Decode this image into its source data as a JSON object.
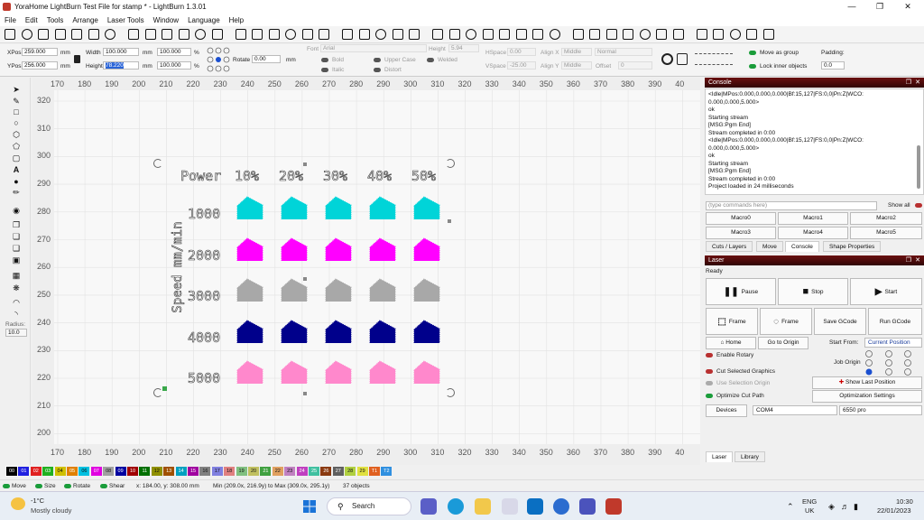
{
  "window": {
    "title": "YoraHome LightBurn Test File  for stamp * - LightBurn 1.3.01"
  },
  "menu": [
    "File",
    "Edit",
    "Tools",
    "Arrange",
    "Laser Tools",
    "Window",
    "Language",
    "Help"
  ],
  "props": {
    "xpos_label": "XPos",
    "xpos": "259.000",
    "ypos_label": "YPos",
    "ypos": "256.000",
    "unit": "mm",
    "width_label": "Width",
    "width": "100.000",
    "height_label": "Height",
    "height": "78.220",
    "scale_w": "100.000",
    "scale_h": "100.000",
    "pct": "%",
    "rotate_label": "Rotate",
    "rotate": "0.00",
    "font_label": "Font",
    "font": "Arial",
    "height5_label": "Height",
    "height5": "5.94",
    "hspace_label": "HSpace",
    "hspace": "0.00",
    "vspace_label": "VSpace",
    "vspace": "-25.00",
    "alignx_label": "Align X",
    "alignx": "Middle",
    "aligny_label": "Align Y",
    "aligny": "Middle",
    "mode": "Normal",
    "offset_label": "Offset",
    "offset": "0",
    "bold": "Bold",
    "italic": "Italic",
    "upper": "Upper Case",
    "distort": "Distort",
    "welded": "Welded",
    "move_group": "Move as group",
    "lock_inner": "Lock inner objects",
    "padding_label": "Padding:",
    "padding": "0.0"
  },
  "ruler": {
    "top": [
      "170",
      "180",
      "190",
      "200",
      "210",
      "220",
      "230",
      "240",
      "250",
      "260",
      "270",
      "280",
      "290",
      "300",
      "310",
      "320",
      "330",
      "340",
      "350",
      "360",
      "370",
      "380",
      "390",
      "40"
    ],
    "left": [
      "320",
      "310",
      "300",
      "290",
      "280",
      "270",
      "260",
      "250",
      "240",
      "230",
      "220",
      "210",
      "200"
    ]
  },
  "left_tools": {
    "radius_label": "Radius:",
    "radius": "10.0"
  },
  "design": {
    "power_label": "Power",
    "cols": [
      "10%",
      "20%",
      "30%",
      "40%",
      "50%"
    ],
    "speed_label": "Speed mm/min",
    "rows": [
      "1000",
      "2000",
      "3000",
      "4000",
      "5000"
    ],
    "row_colors": [
      "#00d4d8",
      "#ff00ff",
      "#a8a8a8",
      "#00008b",
      "#ff88cc"
    ]
  },
  "console": {
    "title": "Console",
    "lines": [
      "<Idle|MPos:0.000,0.000,0.000|Bf:15,127|FS:0,0|Pn:Z|WCO:",
      "0.000,0.000,5.000>",
      "ok",
      "Starting stream",
      "[MSG:Pgm End]",
      "Stream completed in 0:00",
      "<Idle|MPos:0.000,0.000,0.000|Bf:15,127|FS:0,0|Pn:Z|WCO:",
      "0.000,0.000,5.000>",
      "ok",
      "Starting stream",
      "[MSG:Pgm End]",
      "Stream completed in 0:00",
      "Project loaded in 24 milliseconds"
    ],
    "input_placeholder": "(type commands here)",
    "show_all": "Show all",
    "macros": [
      "Macro0",
      "Macro1",
      "Macro2",
      "Macro3",
      "Macro4",
      "Macro5"
    ]
  },
  "tabs1": [
    "Cuts / Layers",
    "Move",
    "Console",
    "Shape Properties"
  ],
  "laser": {
    "title": "Laser",
    "status": "Ready",
    "pause": "Pause",
    "stop": "Stop",
    "start": "Start",
    "frame1": "Frame",
    "frame2": "Frame",
    "save_gcode": "Save GCode",
    "run_gcode": "Run GCode",
    "home": "Home",
    "go_origin": "Go to Origin",
    "start_from_label": "Start From:",
    "start_from": "Current Position",
    "enable_rotary": "Enable Rotary",
    "job_origin": "Job Origin",
    "cut_selected": "Cut Selected Graphics",
    "use_sel_origin": "Use Selection Origin",
    "show_last": "Show Last Position",
    "optimize_cut": "Optimize Cut Path",
    "opt_settings": "Optimization Settings",
    "devices": "Devices",
    "port": "COM4",
    "device": "6550 pro"
  },
  "tabs2": [
    "Laser",
    "Library"
  ],
  "palette": [
    {
      "l": "00",
      "c": "#000000"
    },
    {
      "l": "01",
      "c": "#2020e0"
    },
    {
      "l": "02",
      "c": "#e02020"
    },
    {
      "l": "03",
      "c": "#20b020"
    },
    {
      "l": "04",
      "c": "#d0c000"
    },
    {
      "l": "05",
      "c": "#e08000"
    },
    {
      "l": "06",
      "c": "#00c0e0"
    },
    {
      "l": "07",
      "c": "#e000e0"
    },
    {
      "l": "08",
      "c": "#a0a0a0"
    },
    {
      "l": "09",
      "c": "#0000a0"
    },
    {
      "l": "10",
      "c": "#a00000"
    },
    {
      "l": "11",
      "c": "#007000"
    },
    {
      "l": "12",
      "c": "#909000"
    },
    {
      "l": "13",
      "c": "#a05000"
    },
    {
      "l": "14",
      "c": "#00a0c0"
    },
    {
      "l": "15",
      "c": "#a000a0"
    },
    {
      "l": "16",
      "c": "#808080"
    },
    {
      "l": "17",
      "c": "#8080e0"
    },
    {
      "l": "18",
      "c": "#e08080"
    },
    {
      "l": "19",
      "c": "#80c080"
    },
    {
      "l": "20",
      "c": "#c0c060"
    },
    {
      "l": "21",
      "c": "#40a040"
    },
    {
      "l": "22",
      "c": "#e0a060"
    },
    {
      "l": "23",
      "c": "#c080c0"
    },
    {
      "l": "24",
      "c": "#c040c0"
    },
    {
      "l": "25",
      "c": "#40c0a0"
    },
    {
      "l": "26",
      "c": "#8a3a10"
    },
    {
      "l": "27",
      "c": "#606060"
    },
    {
      "l": "28",
      "c": "#b0d040"
    },
    {
      "l": "29",
      "c": "#e0e040"
    },
    {
      "l": "T1",
      "c": "#e06020"
    },
    {
      "l": "T2",
      "c": "#3090e0"
    }
  ],
  "status": {
    "move": "Move",
    "size": "Size",
    "rotate": "Rotate",
    "shear": "Shear",
    "coords": "x: 184.00, y: 308.00 mm",
    "minmax": "Min (209.0x, 216.9y) to Max (309.0x, 295.1y)",
    "objects": "37 objects"
  },
  "taskbar": {
    "temp": "-1°C",
    "weather": "Mostly cloudy",
    "search": "Search",
    "lang1": "ENG",
    "lang2": "UK",
    "time": "10:30",
    "date": "22/01/2023"
  }
}
